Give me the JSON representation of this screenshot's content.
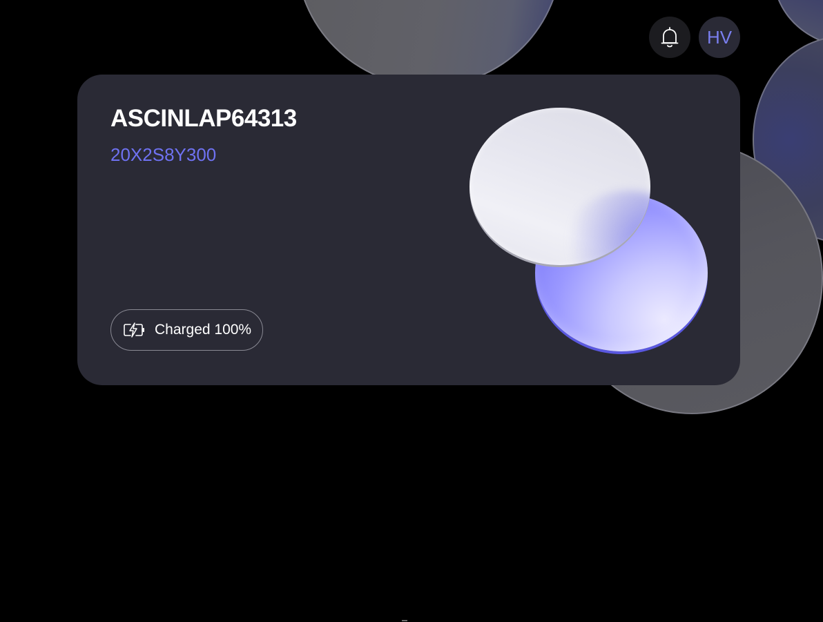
{
  "header": {
    "notifications_icon": "bell-icon",
    "avatar_initials": "HV"
  },
  "device": {
    "name": "ASCINLAP64313",
    "serial": "20X2S8Y300",
    "status": {
      "icon": "battery-charging-icon",
      "label": "Charged 100%",
      "charge_percent": 100
    }
  },
  "colors": {
    "background": "#000000",
    "card": "#2a2a35",
    "accent": "#6f72f2",
    "text": "#ffffff"
  }
}
